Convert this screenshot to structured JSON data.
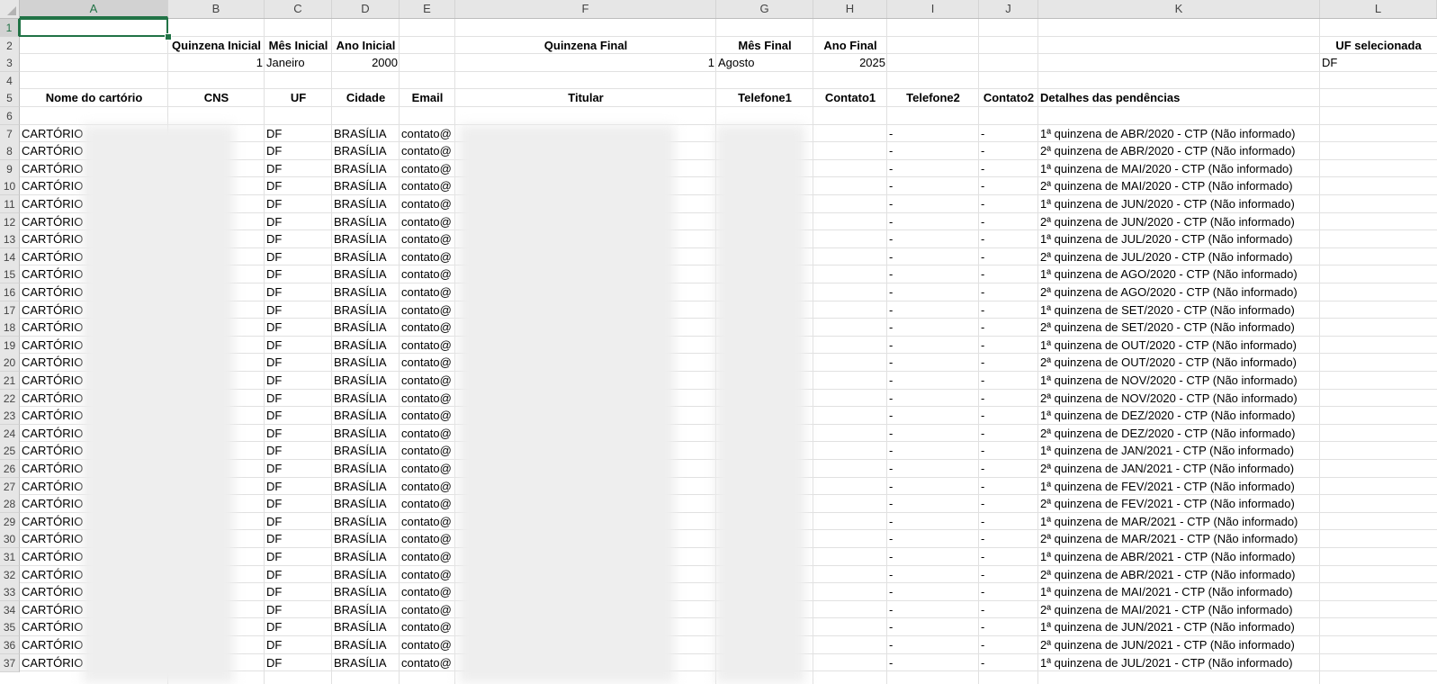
{
  "sheet": {
    "columns": [
      "A",
      "B",
      "C",
      "D",
      "E",
      "F",
      "G",
      "H",
      "I",
      "J",
      "K",
      "L"
    ],
    "selected_column": "A",
    "selected_row": 1,
    "row_numbers": [
      1,
      2,
      3,
      4,
      5,
      6,
      7,
      8,
      9,
      10,
      11,
      12,
      13,
      14,
      15,
      16,
      17,
      18,
      19,
      20,
      21,
      22,
      23,
      24,
      25,
      26,
      27,
      28,
      29,
      30,
      31,
      32,
      33,
      34,
      35,
      36,
      37
    ]
  },
  "params_header": {
    "quinzena_inicial": "Quinzena Inicial",
    "mes_inicial": "Mês Inicial",
    "ano_inicial": "Ano Inicial",
    "quinzena_final": "Quinzena Final",
    "mes_final": "Mês Final",
    "ano_final": "Ano Final",
    "uf_selecionada": "UF selecionada"
  },
  "params_values": {
    "quinzena_inicial": "1",
    "mes_inicial": "Janeiro",
    "ano_inicial": "2000",
    "quinzena_final": "1",
    "mes_final": "Agosto",
    "ano_final": "2025",
    "uf_selecionada": "DF"
  },
  "table_headers": [
    "Nome do cartório",
    "CNS",
    "UF",
    "Cidade",
    "Email",
    "Titular",
    "Telefone1",
    "Contato1",
    "Telefone2",
    "Contato2",
    "Detalhes das pendências"
  ],
  "rows": [
    {
      "nome": "CARTÓRIO",
      "uf": "DF",
      "cidade": "BRASÍLIA",
      "email": "contato@",
      "tel2": "-",
      "contato2": "-",
      "detalhe": "1ª quinzena de ABR/2020 -  CTP (Não informado)"
    },
    {
      "nome": "CARTÓRIO",
      "uf": "DF",
      "cidade": "BRASÍLIA",
      "email": "contato@",
      "tel2": "-",
      "contato2": "-",
      "detalhe": "2ª quinzena de ABR/2020 -  CTP (Não informado)"
    },
    {
      "nome": "CARTÓRIO",
      "uf": "DF",
      "cidade": "BRASÍLIA",
      "email": "contato@",
      "tel2": "-",
      "contato2": "-",
      "detalhe": "1ª quinzena de MAI/2020 -  CTP (Não informado)"
    },
    {
      "nome": "CARTÓRIO",
      "uf": "DF",
      "cidade": "BRASÍLIA",
      "email": "contato@",
      "tel2": "-",
      "contato2": "-",
      "detalhe": "2ª quinzena de MAI/2020 -  CTP (Não informado)"
    },
    {
      "nome": "CARTÓRIO",
      "uf": "DF",
      "cidade": "BRASÍLIA",
      "email": "contato@",
      "tel2": "-",
      "contato2": "-",
      "detalhe": "1ª quinzena de JUN/2020 -  CTP (Não informado)"
    },
    {
      "nome": "CARTÓRIO",
      "uf": "DF",
      "cidade": "BRASÍLIA",
      "email": "contato@",
      "tel2": "-",
      "contato2": "-",
      "detalhe": "2ª quinzena de JUN/2020 -  CTP (Não informado)"
    },
    {
      "nome": "CARTÓRIO",
      "uf": "DF",
      "cidade": "BRASÍLIA",
      "email": "contato@",
      "tel2": "-",
      "contato2": "-",
      "detalhe": "1ª quinzena de JUL/2020 -  CTP (Não informado)"
    },
    {
      "nome": "CARTÓRIO",
      "uf": "DF",
      "cidade": "BRASÍLIA",
      "email": "contato@",
      "tel2": "-",
      "contato2": "-",
      "detalhe": "2ª quinzena de JUL/2020 -  CTP (Não informado)"
    },
    {
      "nome": "CARTÓRIO",
      "uf": "DF",
      "cidade": "BRASÍLIA",
      "email": "contato@",
      "tel2": "-",
      "contato2": "-",
      "detalhe": "1ª quinzena de AGO/2020 -  CTP (Não informado)"
    },
    {
      "nome": "CARTÓRIO",
      "uf": "DF",
      "cidade": "BRASÍLIA",
      "email": "contato@",
      "tel2": "-",
      "contato2": "-",
      "detalhe": "2ª quinzena de AGO/2020 -  CTP (Não informado)"
    },
    {
      "nome": "CARTÓRIO",
      "uf": "DF",
      "cidade": "BRASÍLIA",
      "email": "contato@",
      "tel2": "-",
      "contato2": "-",
      "detalhe": "1ª quinzena de SET/2020 -  CTP (Não informado)"
    },
    {
      "nome": "CARTÓRIO",
      "uf": "DF",
      "cidade": "BRASÍLIA",
      "email": "contato@",
      "tel2": "-",
      "contato2": "-",
      "detalhe": "2ª quinzena de SET/2020 -  CTP (Não informado)"
    },
    {
      "nome": "CARTÓRIO",
      "uf": "DF",
      "cidade": "BRASÍLIA",
      "email": "contato@",
      "tel2": "-",
      "contato2": "-",
      "detalhe": "1ª quinzena de OUT/2020 -  CTP (Não informado)"
    },
    {
      "nome": "CARTÓRIO",
      "uf": "DF",
      "cidade": "BRASÍLIA",
      "email": "contato@",
      "tel2": "-",
      "contato2": "-",
      "detalhe": "2ª quinzena de OUT/2020 -  CTP (Não informado)"
    },
    {
      "nome": "CARTÓRIO",
      "uf": "DF",
      "cidade": "BRASÍLIA",
      "email": "contato@",
      "tel2": "-",
      "contato2": "-",
      "detalhe": "1ª quinzena de NOV/2020 -  CTP (Não informado)"
    },
    {
      "nome": "CARTÓRIO",
      "uf": "DF",
      "cidade": "BRASÍLIA",
      "email": "contato@",
      "tel2": "-",
      "contato2": "-",
      "detalhe": "2ª quinzena de NOV/2020 -  CTP (Não informado)"
    },
    {
      "nome": "CARTÓRIO",
      "uf": "DF",
      "cidade": "BRASÍLIA",
      "email": "contato@",
      "tel2": "-",
      "contato2": "-",
      "detalhe": "1ª quinzena de DEZ/2020 -  CTP (Não informado)"
    },
    {
      "nome": "CARTÓRIO",
      "uf": "DF",
      "cidade": "BRASÍLIA",
      "email": "contato@",
      "tel2": "-",
      "contato2": "-",
      "detalhe": "2ª quinzena de DEZ/2020 -  CTP (Não informado)"
    },
    {
      "nome": "CARTÓRIO",
      "uf": "DF",
      "cidade": "BRASÍLIA",
      "email": "contato@",
      "tel2": "-",
      "contato2": "-",
      "detalhe": "1ª quinzena de JAN/2021 -  CTP (Não informado)"
    },
    {
      "nome": "CARTÓRIO",
      "uf": "DF",
      "cidade": "BRASÍLIA",
      "email": "contato@",
      "tel2": "-",
      "contato2": "-",
      "detalhe": "2ª quinzena de JAN/2021 -  CTP (Não informado)"
    },
    {
      "nome": "CARTÓRIO",
      "uf": "DF",
      "cidade": "BRASÍLIA",
      "email": "contato@",
      "tel2": "-",
      "contato2": "-",
      "detalhe": "1ª quinzena de FEV/2021 -  CTP (Não informado)"
    },
    {
      "nome": "CARTÓRIO",
      "uf": "DF",
      "cidade": "BRASÍLIA",
      "email": "contato@",
      "tel2": "-",
      "contato2": "-",
      "detalhe": "2ª quinzena de FEV/2021 -  CTP (Não informado)"
    },
    {
      "nome": "CARTÓRIO",
      "uf": "DF",
      "cidade": "BRASÍLIA",
      "email": "contato@",
      "tel2": "-",
      "contato2": "-",
      "detalhe": "1ª quinzena de MAR/2021 -  CTP (Não informado)"
    },
    {
      "nome": "CARTÓRIO",
      "uf": "DF",
      "cidade": "BRASÍLIA",
      "email": "contato@",
      "tel2": "-",
      "contato2": "-",
      "detalhe": "2ª quinzena de MAR/2021 -  CTP (Não informado)"
    },
    {
      "nome": "CARTÓRIO",
      "uf": "DF",
      "cidade": "BRASÍLIA",
      "email": "contato@",
      "tel2": "-",
      "contato2": "-",
      "detalhe": "1ª quinzena de ABR/2021 -  CTP (Não informado)"
    },
    {
      "nome": "CARTÓRIO",
      "uf": "DF",
      "cidade": "BRASÍLIA",
      "email": "contato@",
      "tel2": "-",
      "contato2": "-",
      "detalhe": "2ª quinzena de ABR/2021 -  CTP (Não informado)"
    },
    {
      "nome": "CARTÓRIO",
      "uf": "DF",
      "cidade": "BRASÍLIA",
      "email": "contato@",
      "tel2": "-",
      "contato2": "-",
      "detalhe": "1ª quinzena de MAI/2021 -  CTP (Não informado)"
    },
    {
      "nome": "CARTÓRIO",
      "uf": "DF",
      "cidade": "BRASÍLIA",
      "email": "contato@",
      "tel2": "-",
      "contato2": "-",
      "detalhe": "2ª quinzena de MAI/2021 -  CTP (Não informado)"
    },
    {
      "nome": "CARTÓRIO",
      "uf": "DF",
      "cidade": "BRASÍLIA",
      "email": "contato@",
      "tel2": "-",
      "contato2": "-",
      "detalhe": "1ª quinzena de JUN/2021 -  CTP (Não informado)"
    },
    {
      "nome": "CARTÓRIO",
      "uf": "DF",
      "cidade": "BRASÍLIA",
      "email": "contato@",
      "tel2": "-",
      "contato2": "-",
      "detalhe": "2ª quinzena de JUN/2021 -  CTP (Não informado)"
    },
    {
      "nome": "CARTÓRIO",
      "uf": "DF",
      "cidade": "BRASÍLIA",
      "email": "contato@",
      "tel2": "-",
      "contato2": "-",
      "detalhe": "1ª quinzena de JUL/2021 -  CTP (Não informado)"
    }
  ],
  "colors": {
    "accent": "#217346",
    "header_bg": "#e6e6e6",
    "gridline": "#e1e1e1"
  }
}
